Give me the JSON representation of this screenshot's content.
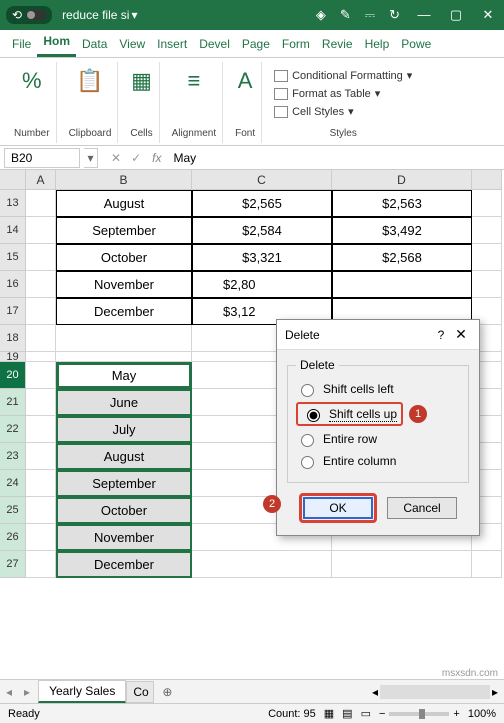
{
  "title": "reduce file si",
  "menu": {
    "file": "File",
    "home": "Hom",
    "data": "Data",
    "view": "View",
    "insert": "Insert",
    "devel": "Devel",
    "page": "Page",
    "form": "Form",
    "revie": "Revie",
    "help": "Help",
    "powe": "Powe"
  },
  "ribbon": {
    "number": "Number",
    "clipboard": "Clipboard",
    "cells": "Cells",
    "alignment": "Alignment",
    "font": "Font",
    "cond": "Conditional Formatting",
    "table": "Format as Table",
    "styles": "Cell Styles",
    "stylesGroup": "Styles"
  },
  "namebox": "B20",
  "formula": "May",
  "cols": {
    "A": "A",
    "B": "B",
    "C": "C",
    "D": "D"
  },
  "rows": [
    "13",
    "14",
    "15",
    "16",
    "17",
    "18",
    "19",
    "20",
    "21",
    "22",
    "23",
    "24",
    "25",
    "26",
    "27"
  ],
  "table1": [
    {
      "b": "August",
      "c": "$2,565",
      "d": "$2,563"
    },
    {
      "b": "September",
      "c": "$2,584",
      "d": "$3,492"
    },
    {
      "b": "October",
      "c": "$3,321",
      "d": "$2,568"
    },
    {
      "b": "November",
      "c": "$2,80",
      "d": ""
    },
    {
      "b": "December",
      "c": "$3,12",
      "d": ""
    }
  ],
  "table2": [
    "May",
    "June",
    "July",
    "August",
    "September",
    "October",
    "November",
    "December"
  ],
  "dialog": {
    "title": "Delete",
    "group": "Delete",
    "opt1": "Shift cells left",
    "opt2": "Shift cells up",
    "opt3": "Entire row",
    "opt4": "Entire column",
    "ok": "OK",
    "cancel": "Cancel",
    "help": "?",
    "close": "✕"
  },
  "tabs": {
    "t1": "Yearly Sales",
    "t2": "Co"
  },
  "status": {
    "ready": "Ready",
    "count": "Count: 95",
    "zoom": "100%"
  },
  "watermark": "msxsdn.com",
  "markers": {
    "m1": "1",
    "m2": "2"
  }
}
